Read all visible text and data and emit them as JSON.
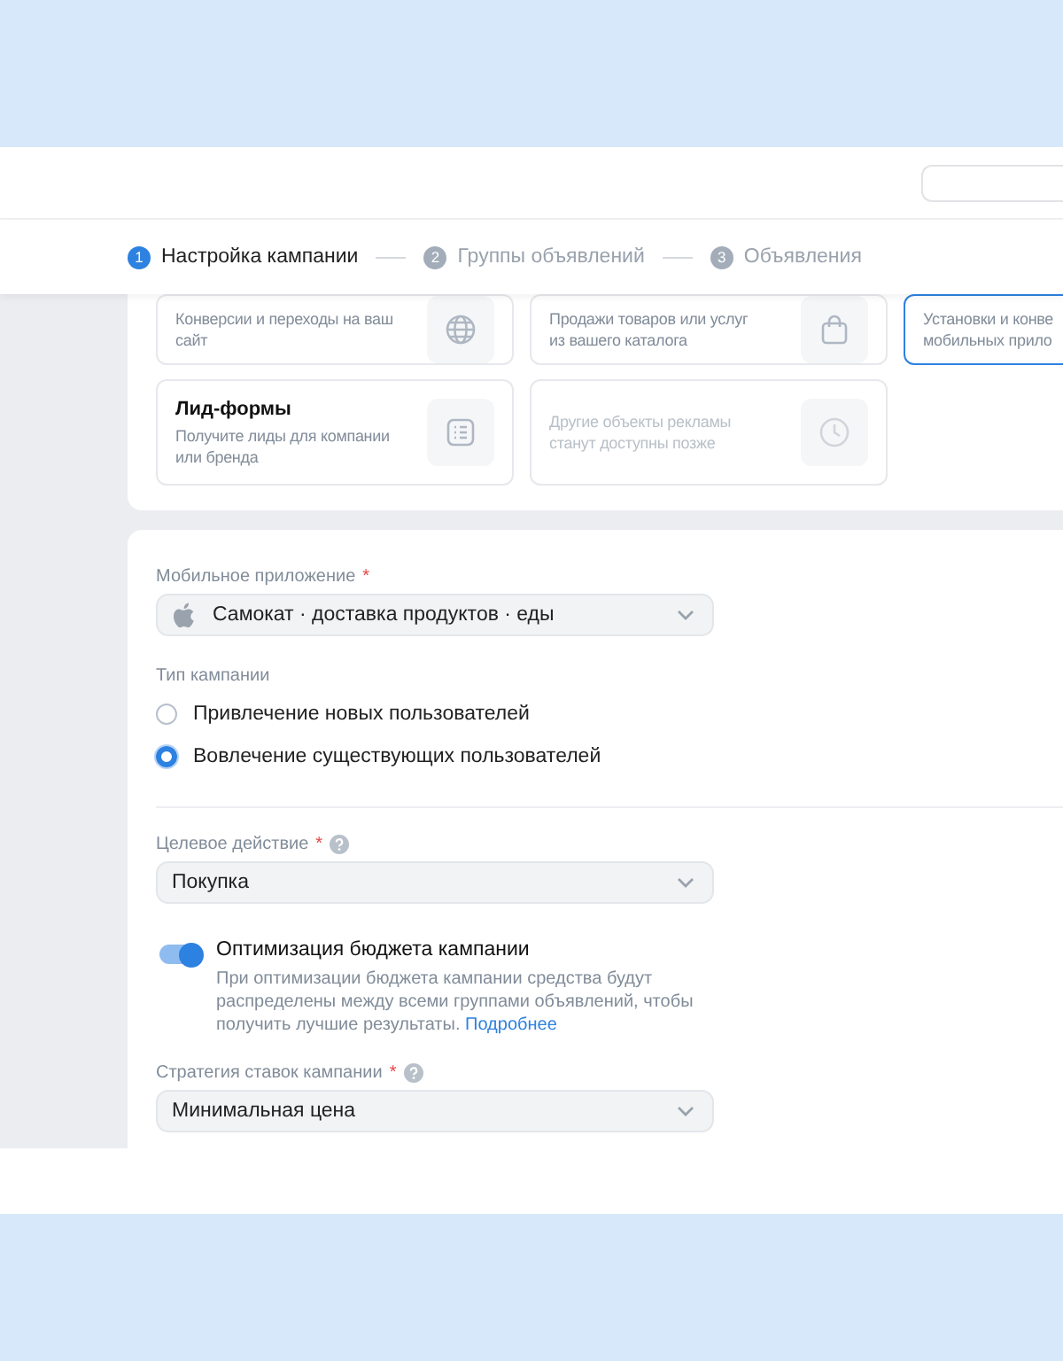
{
  "steps": [
    {
      "number": "1",
      "label": "Настройка кампании",
      "selected": true
    },
    {
      "number": "2",
      "label": "Группы объявлений",
      "selected": false
    },
    {
      "number": "3",
      "label": "Объявления",
      "selected": false
    }
  ],
  "objective_cards": [
    {
      "description_lines": [
        "Конверсии и переходы на ваш",
        "сайт"
      ],
      "kind": "globe",
      "disabled": false,
      "selected": false
    },
    {
      "description_lines": [
        "Продажи товаров или услуг",
        "из вашего каталога"
      ],
      "kind": "bag",
      "disabled": false,
      "selected": false
    },
    {
      "description_lines": [
        "Установки и конве",
        "мобильных прило"
      ],
      "disabled": false,
      "selected": true
    },
    {
      "title": "Лид-формы",
      "description_lines": [
        "Получите лиды для компании",
        "или бренда"
      ],
      "kind": "list",
      "disabled": false,
      "selected": false
    },
    {
      "description_lines": [
        "Другие объекты рекламы",
        "станут доступны позже"
      ],
      "kind": "clock",
      "disabled": true,
      "selected": false
    }
  ],
  "app_field": {
    "label": "Мобильное приложение",
    "required_mark": "*",
    "value": "Самокат · доставка продуктов · еды"
  },
  "campaign_type": {
    "label": "Тип кампании",
    "options": [
      {
        "label": "Привлечение новых пользователей",
        "selected": false
      },
      {
        "label": "Вовлечение существующих пользователей",
        "selected": true
      }
    ]
  },
  "target_action": {
    "label": "Целевое действие",
    "required_mark": "*",
    "help": true,
    "value": "Покупка"
  },
  "budget_optimization": {
    "title": "Оптимизация бюджета кампании",
    "on": true,
    "description": "При оптимизации бюджета кампании средства будут распределены между всеми группами объявлений, чтобы получить лучшие результаты.",
    "link": "Подробнее"
  },
  "bid_strategy": {
    "label": "Стратегия ставок кампании",
    "required_mark": "*",
    "help": true,
    "value": "Минимальная цена"
  }
}
